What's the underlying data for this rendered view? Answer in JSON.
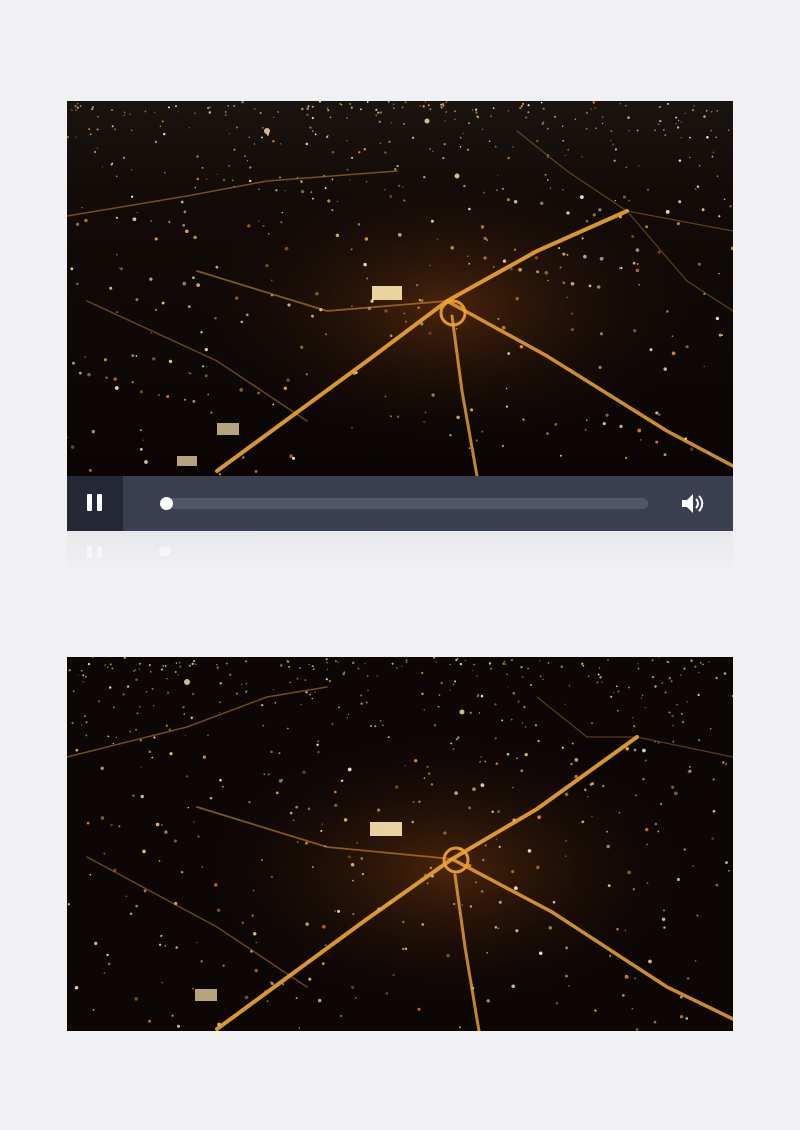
{
  "video_top": {
    "scene": "aerial-night-city",
    "controls": {
      "play_state": "paused-control-visible",
      "play_button_icon": "pause-icon",
      "progress_fraction": 0.0,
      "volume_icon": "speaker-icon"
    }
  },
  "video_bottom": {
    "scene": "aerial-night-city"
  },
  "colors": {
    "page_background": "#f1f1f3",
    "control_bar": "#3b4051",
    "pause_button_bg": "#242834",
    "progress_track": "#515769",
    "street_light": "#f0a533"
  }
}
